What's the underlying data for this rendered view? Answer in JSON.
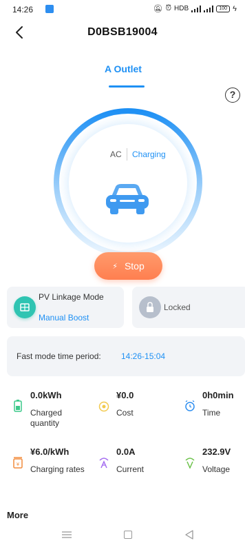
{
  "status_bar": {
    "time": "14:26",
    "network": "HDB",
    "battery_level": "100"
  },
  "header": {
    "title": "D0BSB19004"
  },
  "tabs": [
    {
      "label": "A Outlet",
      "active": true
    }
  ],
  "charging": {
    "mode": "AC",
    "status": "Charging"
  },
  "stop_button": {
    "label": "Stop"
  },
  "pv_linkage": {
    "title": "PV Linkage Mode",
    "mode": "Manual Boost"
  },
  "lock": {
    "label": "Locked"
  },
  "fast_mode": {
    "label": "Fast mode time period:",
    "value": "14:26-15:04"
  },
  "metrics": [
    {
      "value": "0.0kWh",
      "label": "Charged quantity",
      "icon": "battery-icon",
      "color": "#3cc98a"
    },
    {
      "value": "¥0.0",
      "label": "Cost",
      "icon": "coin-icon",
      "color": "#f2c94c"
    },
    {
      "value": "0h0min",
      "label": "Time",
      "icon": "alarm-clock-icon",
      "color": "#2d8ef0"
    },
    {
      "value": "¥6.0/kWh",
      "label": "Charging rates",
      "icon": "rate-icon",
      "color": "#f28c3c"
    },
    {
      "value": "0.0A",
      "label": "Current",
      "icon": "current-icon",
      "color": "#a46cf0"
    },
    {
      "value": "232.9V",
      "label": "Voltage",
      "icon": "voltage-icon",
      "color": "#6cc24a"
    }
  ],
  "more": {
    "label": "More"
  },
  "colors": {
    "accent": "#1e90f4",
    "stop": "#ff7f50",
    "card_bg": "#f2f4f7"
  }
}
